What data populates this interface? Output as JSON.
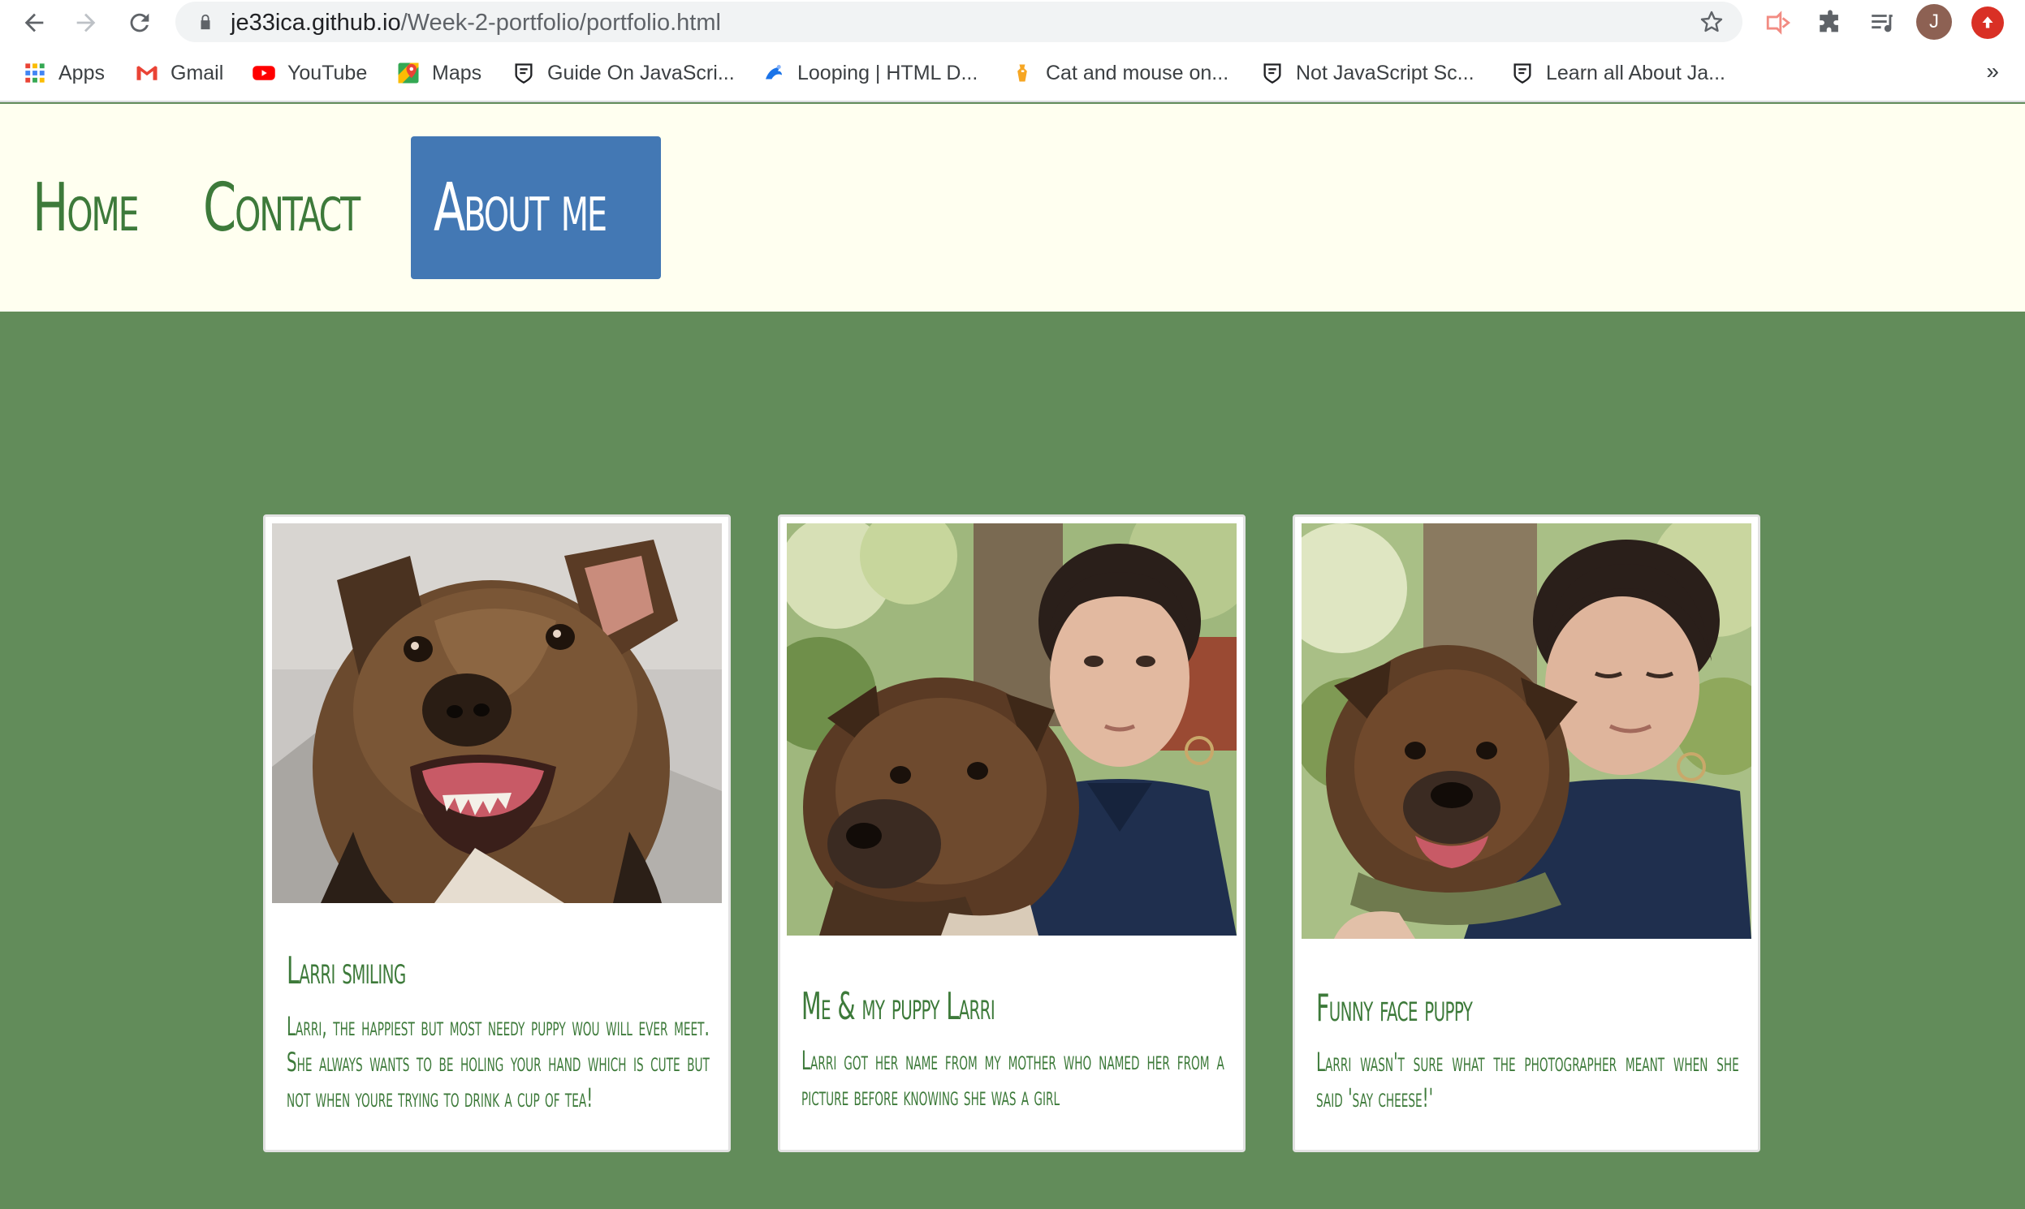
{
  "browser": {
    "url_host": "je33ica.github.io",
    "url_path": "/Week-2-portfolio/portfolio.html",
    "avatar_letter": "J",
    "bookmarks": [
      {
        "label": "Apps",
        "icon": "apps-grid-icon"
      },
      {
        "label": "Gmail",
        "icon": "gmail-icon"
      },
      {
        "label": "YouTube",
        "icon": "youtube-icon"
      },
      {
        "label": "Maps",
        "icon": "maps-icon"
      },
      {
        "label": "Guide On JavaScri...",
        "icon": "shield-icon"
      },
      {
        "label": "Looping | HTML D...",
        "icon": "page-icon"
      },
      {
        "label": "Cat and mouse on...",
        "icon": "orange-page-icon"
      },
      {
        "label": "Not JavaScript Sc...",
        "icon": "shield-icon"
      },
      {
        "label": "Learn all About Ja...",
        "icon": "shield-icon"
      }
    ],
    "more_bookmarks": "»"
  },
  "nav": {
    "home": "Home",
    "contact": "Contact",
    "about": "About me",
    "active_color": "#4378b4",
    "text_color": "#3d7a3a"
  },
  "theme": {
    "header_bg": "#fffff0",
    "main_bg": "#628c5a"
  },
  "cards": [
    {
      "title": "Larri smiling",
      "body": "Larri, the happiest but most needy puppy wou will ever meet. She always wants to be holing your hand which is cute but not when youre trying to drink a cup of tea!",
      "image": "brindle dog smiling"
    },
    {
      "title": "Me & my puppy Larri",
      "body": "Larri got her name from my mother who named her from a picture before knowing she was a girl",
      "image": "woman with brindle dog"
    },
    {
      "title": "Funny face puppy",
      "body": "Larri wasn't sure what the photographer meant when she said 'say cheese!'",
      "image": "woman hugging brindle dog"
    }
  ]
}
